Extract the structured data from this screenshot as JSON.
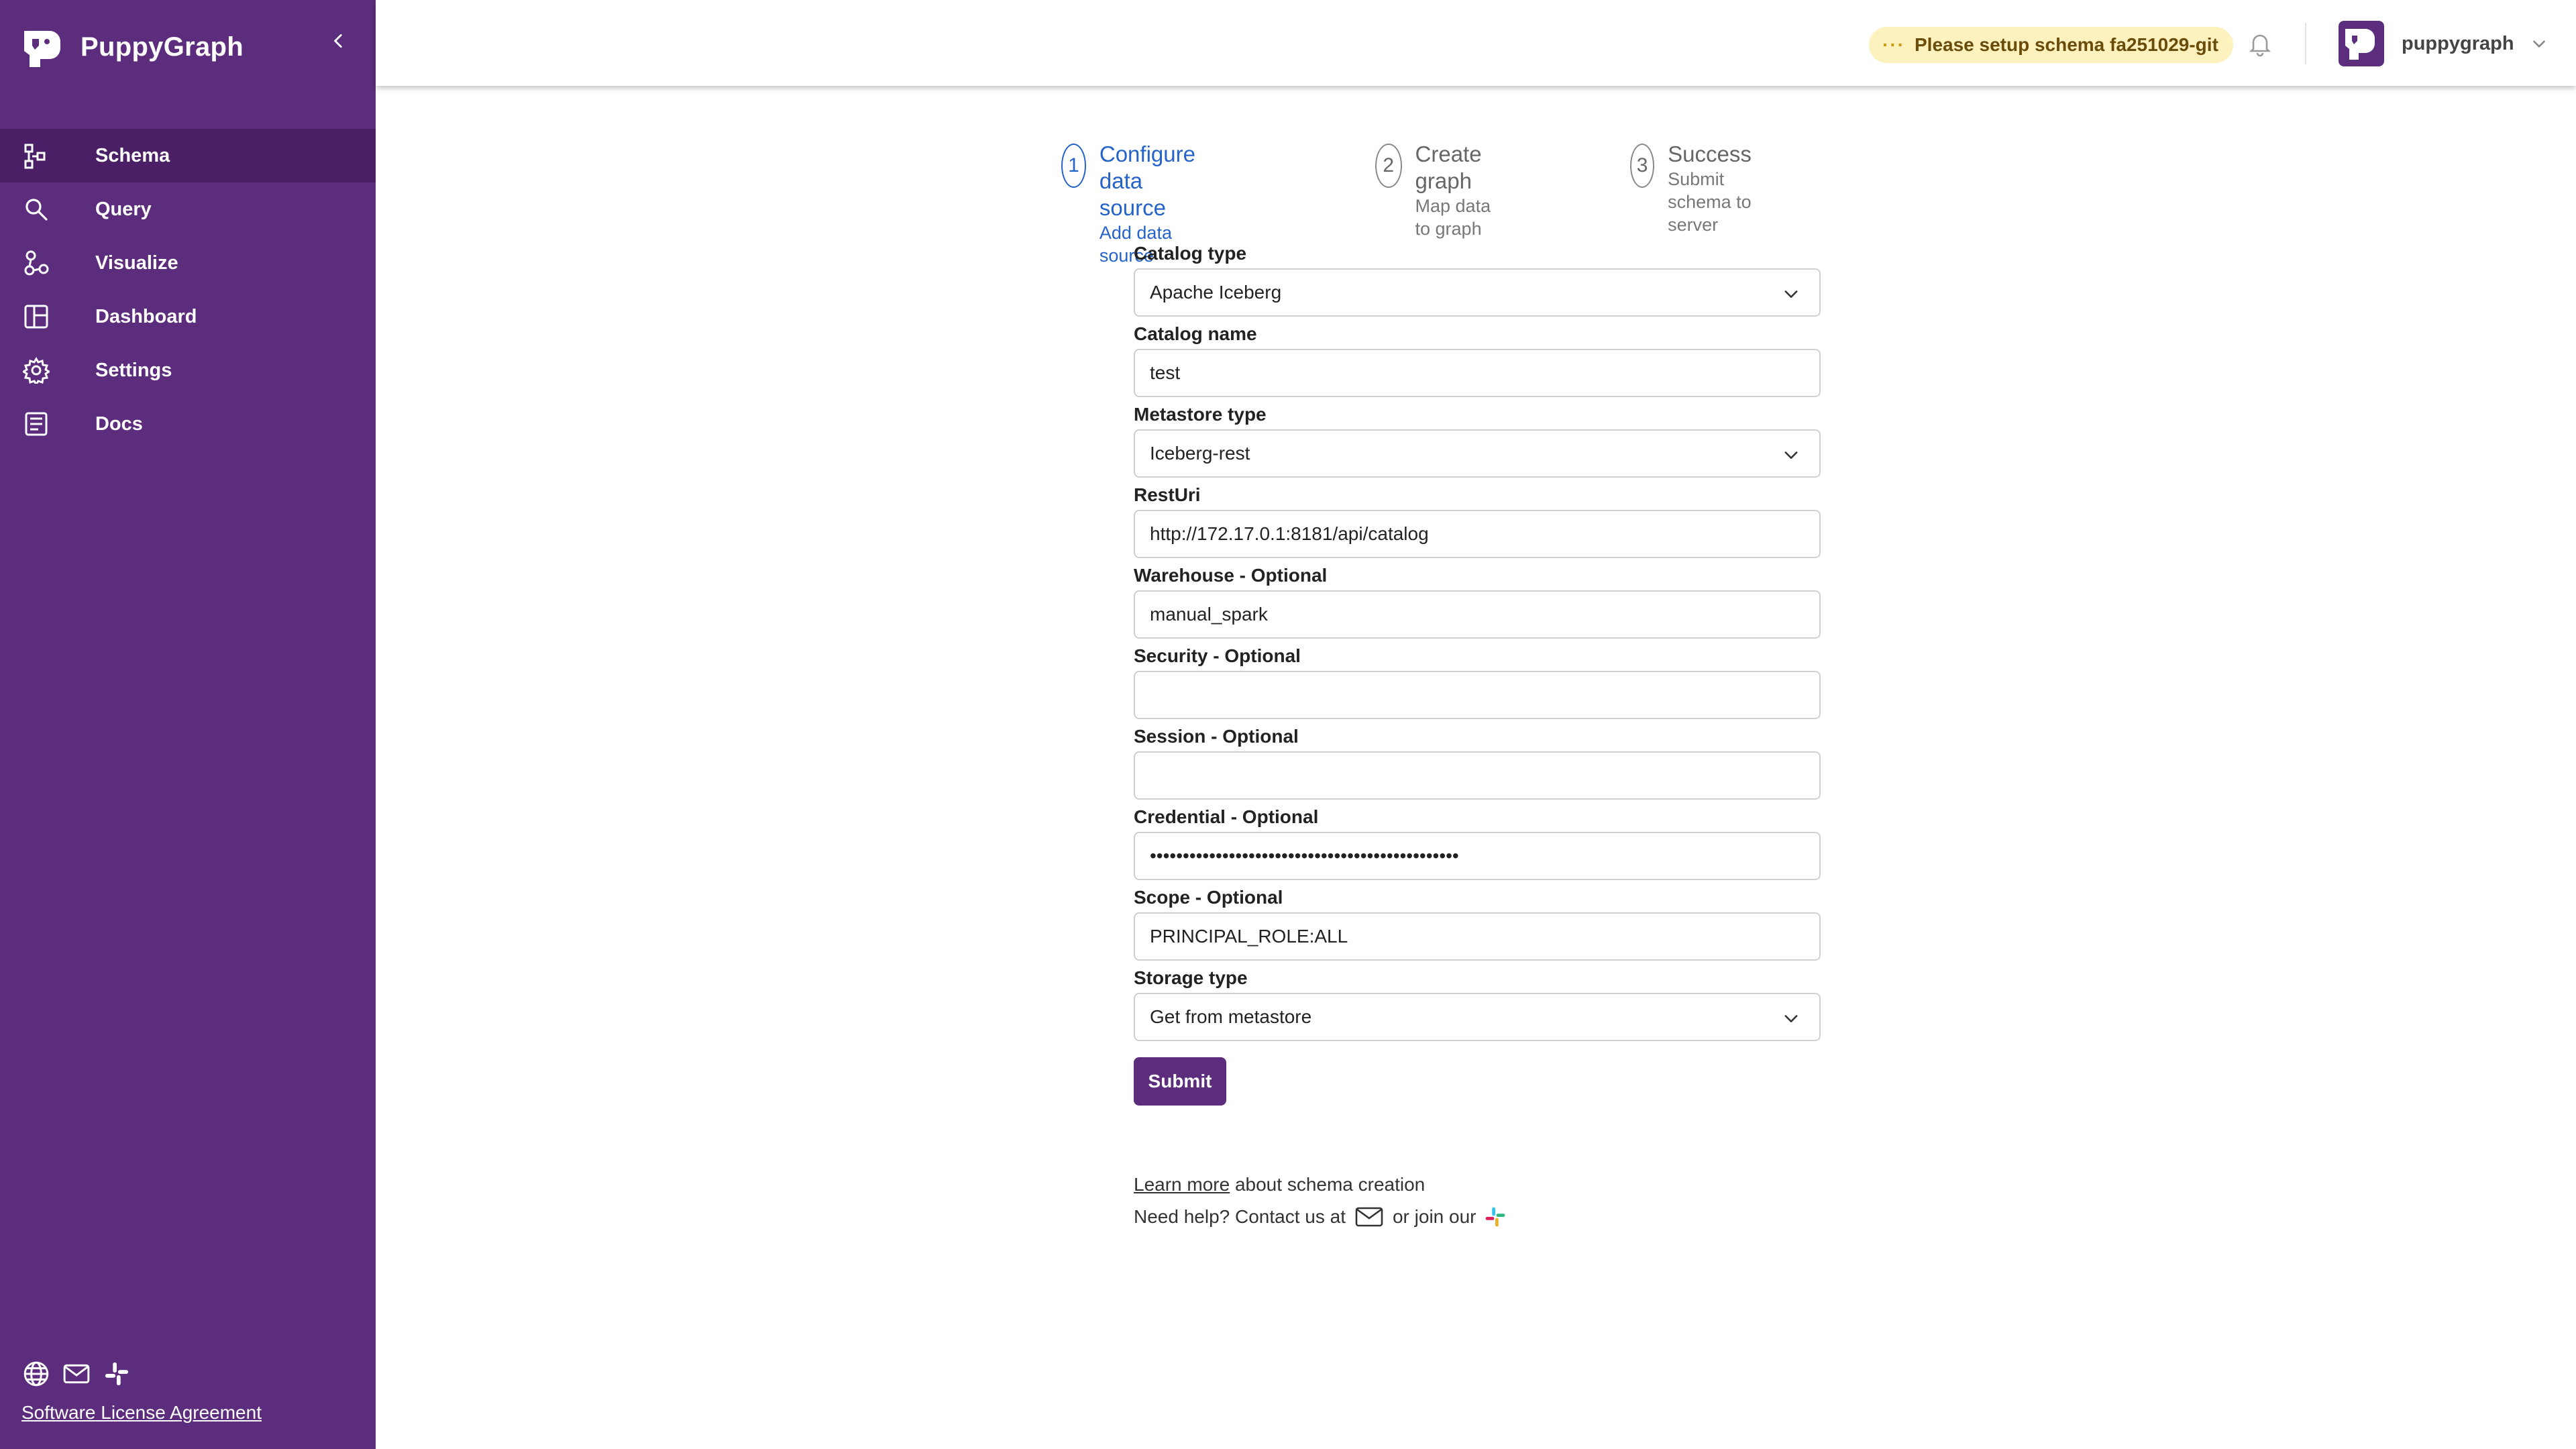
{
  "sidebar": {
    "brand": "PuppyGraph",
    "items": [
      {
        "label": "Schema",
        "icon": "schema-icon",
        "active": true
      },
      {
        "label": "Query",
        "icon": "search-icon",
        "active": false
      },
      {
        "label": "Visualize",
        "icon": "visualize-icon",
        "active": false
      },
      {
        "label": "Dashboard",
        "icon": "dashboard-icon",
        "active": false
      },
      {
        "label": "Settings",
        "icon": "gear-icon",
        "active": false
      },
      {
        "label": "Docs",
        "icon": "docs-icon",
        "active": false
      }
    ],
    "footer_icons": [
      "globe-icon",
      "mail-icon",
      "slack-icon"
    ],
    "license_link": "Software License Agreement"
  },
  "header": {
    "schema_notice": "Please setup schema fa251029-git",
    "user_name": "puppygraph"
  },
  "stepper": [
    {
      "num": "1",
      "title": "Configure data source",
      "subtitle": "Add data source",
      "active": true
    },
    {
      "num": "2",
      "title": "Create graph",
      "subtitle": "Map data to graph",
      "active": false
    },
    {
      "num": "3",
      "title": "Success",
      "subtitle": "Submit schema to server",
      "active": false
    }
  ],
  "form": {
    "catalog_type": {
      "label": "Catalog type",
      "value": "Apache Iceberg"
    },
    "catalog_name": {
      "label": "Catalog name",
      "value": "test"
    },
    "metastore_type": {
      "label": "Metastore type",
      "value": "Iceberg-rest"
    },
    "rest_uri": {
      "label": "RestUri",
      "value": "http://172.17.0.1:8181/api/catalog"
    },
    "warehouse": {
      "label": "Warehouse - Optional",
      "value": "manual_spark"
    },
    "security": {
      "label": "Security - Optional",
      "value": ""
    },
    "session": {
      "label": "Session - Optional",
      "value": ""
    },
    "credential": {
      "label": "Credential - Optional",
      "value": "•••••••••••••••••••••••••••••••••••••••••••••••"
    },
    "scope": {
      "label": "Scope - Optional",
      "value": "PRINCIPAL_ROLE:ALL"
    },
    "storage_type": {
      "label": "Storage type",
      "value": "Get from metastore"
    },
    "submit_label": "Submit"
  },
  "help": {
    "learn_more": "Learn more",
    "learn_more_rest": "about schema creation",
    "need_help": "Need help? Contact us at",
    "or_join": "or join our"
  },
  "colors": {
    "sidebar_bg": "#5d2d7d",
    "sidebar_active": "#4a1f66",
    "accent_blue": "#2563c9",
    "notice_bg": "#fdf1bd"
  }
}
